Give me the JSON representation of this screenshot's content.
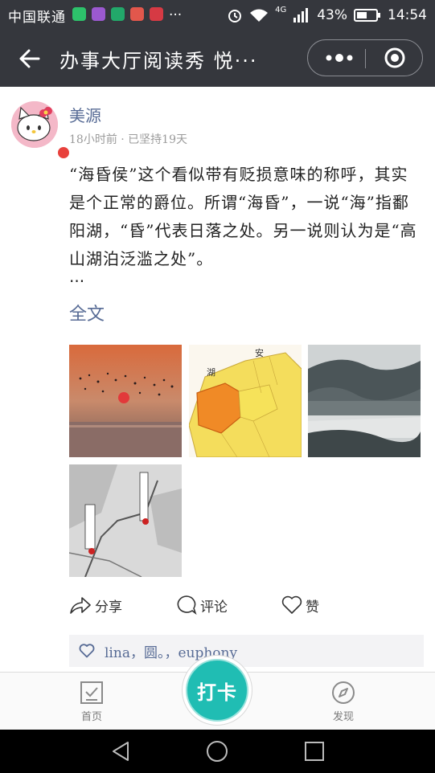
{
  "status_bar": {
    "carrier": "中国联通",
    "overflow": "···",
    "network": "4G",
    "battery": "43%",
    "time": "14:54"
  },
  "header": {
    "title": "办事大厅阅读秀  悦···"
  },
  "post": {
    "username": "美源",
    "meta": "18小时前  ·  已坚持19天",
    "text": "“海昏侯”这个看似带有贬损意味的称呼，其实是个正常的爵位。所谓“海昏”，一说“海”指鄱阳湖，“昏”代表日落之处。另一说则认为是“高山湖泊泛滥之处”。",
    "ellipsis": "···",
    "full_text_link": "全文",
    "photos": [
      "sunset-birds-over-lake",
      "province-map",
      "misty-mountains",
      "route-map"
    ],
    "map_labels": {
      "province": "安",
      "lake": "湖"
    }
  },
  "actions": {
    "share": "分享",
    "comment": "评论",
    "like": "赞"
  },
  "likes_list": "lina，圆。，euphony",
  "tabbar": {
    "home": "首页",
    "punch": "打卡",
    "discover": "发现"
  },
  "colors": {
    "bar_dark": "#35373d",
    "link_blue": "#576b95",
    "punch_teal": "#20bdb3"
  }
}
